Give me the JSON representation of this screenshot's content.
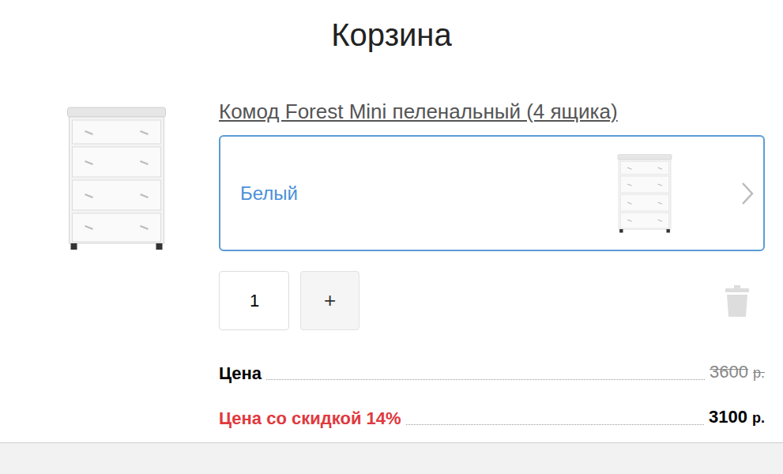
{
  "page": {
    "title": "Корзина"
  },
  "product": {
    "name": "Комод Forest Mini пеленальный (4 ящика)",
    "variant": {
      "label": "Белый"
    },
    "quantity": "1",
    "plus": "+",
    "prices": [
      {
        "label": "Цена",
        "value": "3600",
        "currency": "р.",
        "kind": "regular",
        "struck": true
      },
      {
        "label": "Цена со скидкой 14%",
        "value": "3100",
        "currency": "р.",
        "kind": "discount",
        "struck": false
      }
    ]
  }
}
